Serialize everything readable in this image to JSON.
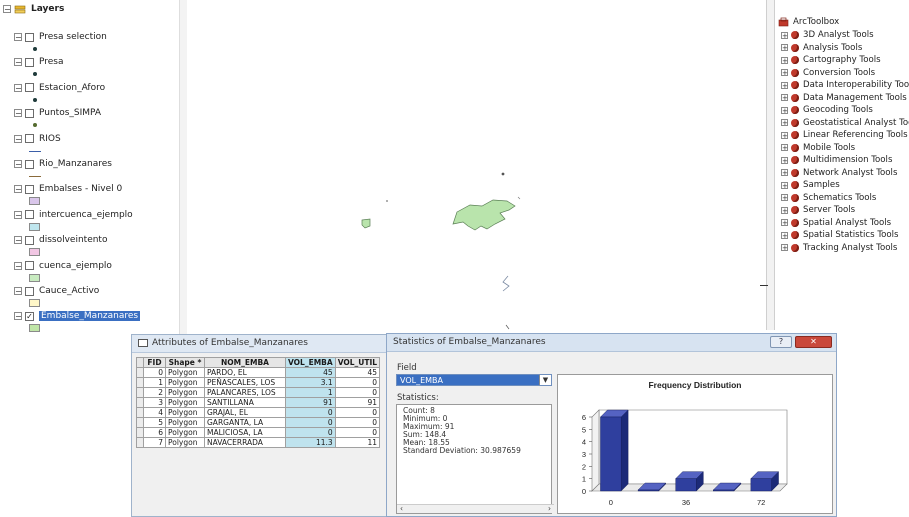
{
  "toc": {
    "root_label": "Layers",
    "layers": [
      {
        "name": "Presa selection",
        "checked": false,
        "symbol": "point-dark"
      },
      {
        "name": "Presa",
        "checked": false,
        "symbol": "point-dark"
      },
      {
        "name": "Estacion_Aforo",
        "checked": false,
        "symbol": "point-dark"
      },
      {
        "name": "Puntos_SIMPA",
        "checked": false,
        "symbol": "point-olive"
      },
      {
        "name": "RIOS",
        "checked": false,
        "symbol": "line-blue"
      },
      {
        "name": "Rio_Manzanares",
        "checked": false,
        "symbol": "line-brown"
      },
      {
        "name": "Embalses - Nivel 0",
        "checked": false,
        "symbol": "poly-lilac"
      },
      {
        "name": "intercuenca_ejemplo",
        "checked": false,
        "symbol": "poly-cyan"
      },
      {
        "name": "dissolveintento",
        "checked": false,
        "symbol": "poly-pink"
      },
      {
        "name": "cuenca_ejemplo",
        "checked": false,
        "symbol": "poly-green"
      },
      {
        "name": "Cauce_Activo",
        "checked": false,
        "symbol": "poly-yellow"
      },
      {
        "name": "Embalse_Manzanares",
        "checked": true,
        "symbol": "poly-green2",
        "selected": true
      }
    ],
    "symbol_colors": {
      "point-dark": "#1f3b3b",
      "point-olive": "#556b2f",
      "line-blue": "#3b5ea8",
      "line-brown": "#8a6a3a",
      "poly-lilac": "#d9c6ea",
      "poly-cyan": "#bfe6ee",
      "poly-pink": "#f1c6e3",
      "poly-green": "#c8ebc0",
      "poly-yellow": "#fff7c8",
      "poly-green2": "#c0e6a8"
    }
  },
  "toolbox": {
    "title": "ArcToolbox",
    "items": [
      "3D Analyst Tools",
      "Analysis Tools",
      "Cartography Tools",
      "Conversion Tools",
      "Data Interoperability Tools",
      "Data Management Tools",
      "Geocoding Tools",
      "Geostatistical Analyst Tools",
      "Linear Referencing Tools",
      "Mobile Tools",
      "Multidimension Tools",
      "Network Analyst Tools",
      "Samples",
      "Schematics Tools",
      "Server Tools",
      "Spatial Analyst Tools",
      "Spatial Statistics Tools",
      "Tracking Analyst Tools"
    ]
  },
  "attributes": {
    "title": "Attributes of Embalse_Manzanares",
    "columns": [
      "FID",
      "Shape *",
      "NOM_EMBA",
      "VOL_EMBA",
      "VOL_UTIL"
    ],
    "rows": [
      [
        "0",
        "Polygon",
        "PARDO, EL",
        "45",
        "45"
      ],
      [
        "1",
        "Polygon",
        "PEÑASCALES, LOS",
        "3.1",
        "0"
      ],
      [
        "2",
        "Polygon",
        "PALANCARES, LOS",
        "1",
        "0"
      ],
      [
        "3",
        "Polygon",
        "SANTILLANA",
        "91",
        "91"
      ],
      [
        "4",
        "Polygon",
        "GRAJAL, EL",
        "0",
        "0"
      ],
      [
        "5",
        "Polygon",
        "GARGANTA, LA",
        "0",
        "0"
      ],
      [
        "6",
        "Polygon",
        "MALICIOSA, LA",
        "0",
        "0"
      ],
      [
        "7",
        "Polygon",
        "NAVACERRADA",
        "11.3",
        "11"
      ]
    ]
  },
  "statistics": {
    "title": "Statistics of Embalse_Manzanares",
    "help_label": "?",
    "close_label": "✕",
    "field_label": "Field",
    "field_value": "VOL_EMBA",
    "stats_label": "Statistics:",
    "lines": [
      "Count:   8",
      "Minimum: 0",
      "Maximum: 91",
      "Sum:     148.4",
      "Mean:    18.55",
      "Standard Deviation: 30.987659"
    ],
    "scroll_left": "‹",
    "scroll_right": "›"
  },
  "chart_data": {
    "type": "bar",
    "title": "Frequency Distribution",
    "x_tick_labels": [
      "0",
      "36",
      "72"
    ],
    "y_ticks": [
      0,
      1,
      2,
      3,
      4,
      5,
      6
    ],
    "ylim": [
      0,
      6
    ],
    "bins": 5,
    "values": [
      6,
      0,
      1,
      0,
      1
    ],
    "bar_color": "#2f3f9e",
    "grid": false,
    "style": "3d"
  }
}
